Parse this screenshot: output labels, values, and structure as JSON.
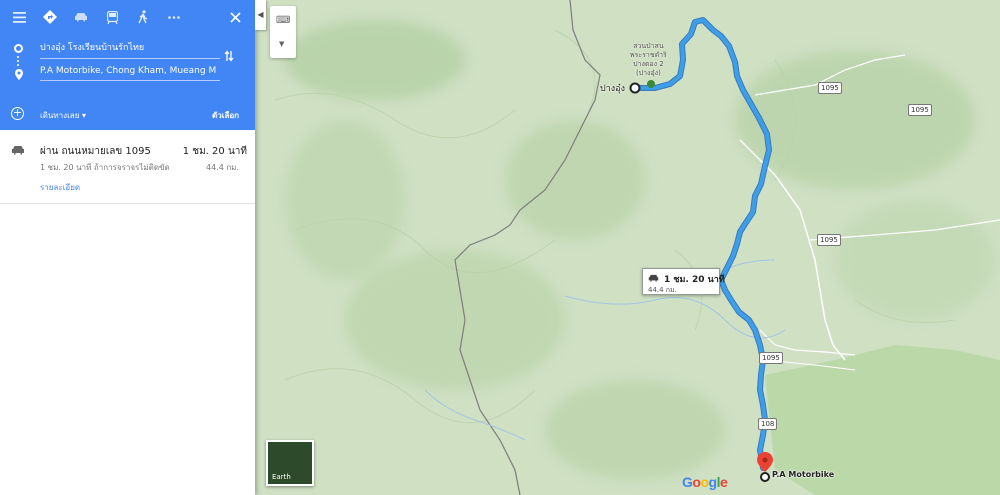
{
  "header": {
    "travel_modes": [
      "menu-icon",
      "directions-icon",
      "car-icon",
      "transit-icon",
      "walk-icon",
      "more-icon"
    ],
    "origin": "ปางอุ๋ง โรงเรียนบ้านรักไทย",
    "destination": "P.A Motorbike, Chong Kham, Mueang M",
    "depart_label": "เดินทางเลย",
    "options_label": "ตัวเลือก"
  },
  "route": {
    "via": "ผ่าน ถนนหมายเลข 1095",
    "duration": "1 ชม. 20 นาที",
    "sub": "1 ชม. 20 นาที ถ้าการจราจรไม่ติดขัด",
    "distance": "44.4 กม.",
    "details_link": "รายละเอียด"
  },
  "map": {
    "origin_label": "ปางอุ๋ง",
    "destination_label": "P.A Motorbike",
    "poi_label_1": "สวนป่าสน",
    "poi_label_2": "พระราชดำริ",
    "poi_label_3": "ปางตอง 2",
    "poi_label_4": "(ปางอุ๋ง)",
    "route_box_time": "1 ชม. 20 นาที",
    "route_box_distance": "44.4 กม.",
    "road_shields": [
      "1095",
      "1095",
      "1095",
      "1095",
      "108",
      "108"
    ],
    "earth_label": "Earth",
    "google_logo": "Google"
  },
  "colors": {
    "header_blue": "#4285f4",
    "route_blue": "#3ca0e8",
    "terrain_green": "#cfe0c3",
    "park_green": "#b7d6a4",
    "link_blue": "#4285f4"
  }
}
